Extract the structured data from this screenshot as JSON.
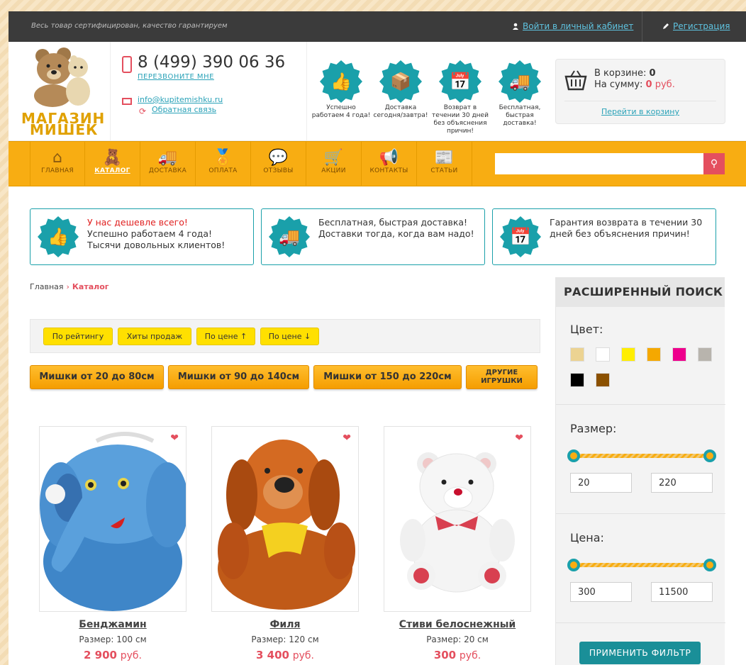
{
  "topbar": {
    "motto": "Весь товар сертифицирован, качество гарантируем",
    "login": "Войти в личный кабинет",
    "register": "Регистрация"
  },
  "header": {
    "brand_line1": "МАГАЗИН",
    "brand_line2": "МИШЕК",
    "phone": "8 (499) 390 06 36",
    "callback": "ПЕРЕЗВОНИТЕ МНЕ",
    "email": "info@kupitemishku.ru",
    "feedback": "Обратная связь",
    "features": [
      {
        "icon": "thumbs-up-icon",
        "glyph": "👍",
        "text": "Успешно работаем 4 года!"
      },
      {
        "icon": "box-icon",
        "glyph": "📦",
        "text": "Доставка сегодня/завтра!"
      },
      {
        "icon": "calendar-icon",
        "glyph": "📅",
        "text": "Возврат в течении 30 дней без объяснения причин!"
      },
      {
        "icon": "truck-icon",
        "glyph": "🚚",
        "text": "Бесплатная, быстрая доставка!"
      }
    ],
    "cart": {
      "in_cart_label": "В корзине:",
      "in_cart_value": "0",
      "sum_label": "На сумму:",
      "sum_value": "0",
      "sum_currency": "руб.",
      "go_to_cart": "Перейти в корзину"
    }
  },
  "nav": {
    "items": [
      {
        "label": "ГЛАВНАЯ",
        "glyph": "⌂",
        "icon": "home-icon"
      },
      {
        "label": "КАТАЛОГ",
        "glyph": "🧸",
        "icon": "bear-icon",
        "active": true
      },
      {
        "label": "ДОСТАВКА",
        "glyph": "🚚",
        "icon": "truck-icon"
      },
      {
        "label": "ОПЛАТА",
        "glyph": "🏅",
        "icon": "medal-icon"
      },
      {
        "label": "ОТЗЫВЫ",
        "glyph": "💬",
        "icon": "chat-icon"
      },
      {
        "label": "АКЦИИ",
        "glyph": "🛒",
        "icon": "cart-icon"
      },
      {
        "label": "КОНТАКТЫ",
        "glyph": "📢",
        "icon": "megaphone-icon"
      },
      {
        "label": "СТАТЬИ",
        "glyph": "📰",
        "icon": "articles-icon"
      }
    ],
    "search_placeholder": ""
  },
  "benefits": [
    {
      "icon": "thumbs-up-icon",
      "glyph": "👍",
      "highlight": "У нас дешевле всего!",
      "line2": "Успешно работаем 4 года!",
      "line3": "Тысячи довольных клиентов!"
    },
    {
      "icon": "truck-icon",
      "glyph": "🚚",
      "highlight": "",
      "line2": "Бесплатная, быстрая доставка!",
      "line3": "Доставки тогда, когда вам надо!"
    },
    {
      "icon": "calendar-icon",
      "glyph": "📅",
      "highlight": "",
      "line2": "Гарантия возврата в течении 30",
      "line3": "дней без объяснения причин!"
    }
  ],
  "breadcrumb": {
    "home": "Главная",
    "current": "Каталог"
  },
  "sort": [
    "По рейтингу",
    "Хиты продаж",
    "По цене ↑",
    "По цене ↓"
  ],
  "size_filters": [
    "Мишки от 20 до 80см",
    "Мишки от 90 до 140см",
    "Мишки от 150 до 220см"
  ],
  "other_toys": {
    "line1": "ДРУГИЕ",
    "line2": "ИГРУШКИ"
  },
  "products": [
    {
      "name": "Бенджамин",
      "size": "Размер: 100 см",
      "price": "2 900",
      "currency": "руб."
    },
    {
      "name": "Филя",
      "size": "Размер: 120 см",
      "price": "3 400",
      "currency": "руб."
    },
    {
      "name": "Стиви белоснежный",
      "size": "Размер: 20 см",
      "price": "300",
      "currency": "руб."
    }
  ],
  "filter": {
    "title": "РАСШИРЕННЫЙ ПОИСК",
    "color_label": "Цвет:",
    "colors": [
      "#ecd392",
      "#ffffff",
      "#ffee00",
      "#f5a800",
      "#ee008c",
      "#b8b4ad",
      "#000000",
      "#8b5000"
    ],
    "size_label": "Размер:",
    "size_min": "20",
    "size_max": "220",
    "price_label": "Цена:",
    "price_min": "300",
    "price_max": "11500",
    "apply": "ПРИМЕНИТЬ ФИЛЬТР"
  }
}
